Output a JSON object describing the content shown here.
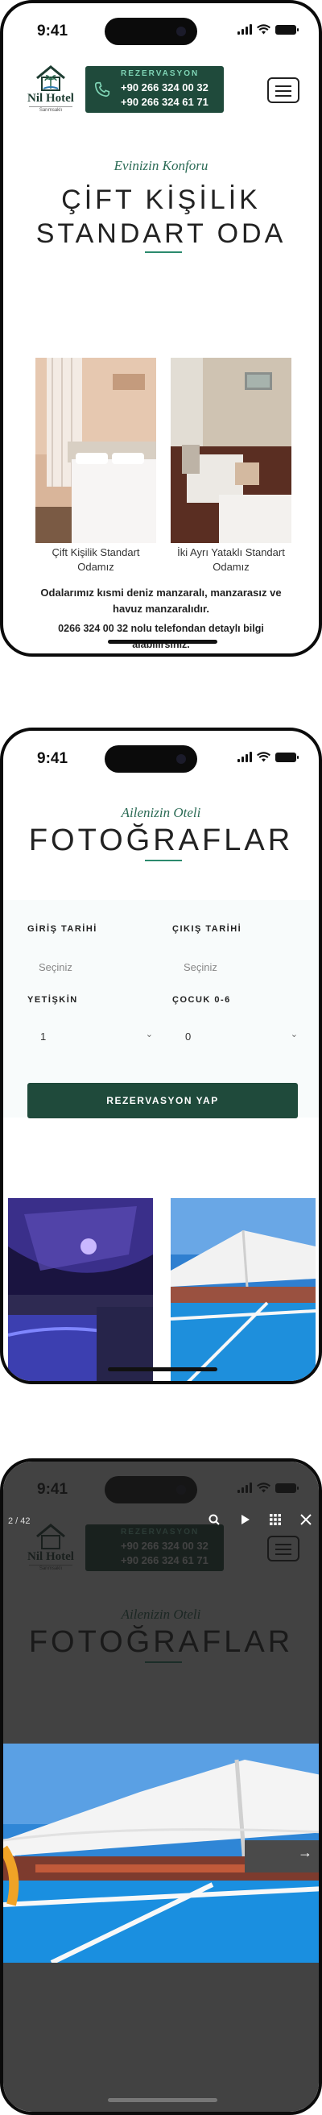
{
  "status": {
    "time": "9:41"
  },
  "header": {
    "logo_name": "Nil Hotel",
    "logo_sub": "Sarımsaklı",
    "rez_title": "REZERVASYON",
    "phone1": "+90 266 324 00 32",
    "phone2": "+90 266 324 61 71"
  },
  "room_section": {
    "kicker": "Evinizin Konforu",
    "title_line1": "ÇİFT KİŞİLİK",
    "title_line2": "STANDART ODA",
    "rooms": [
      {
        "caption_line1": "Çift Kişilik Standart",
        "caption_line2": "Odamız"
      },
      {
        "caption_line1": "İki Ayrı Yataklı Standart",
        "caption_line2": "Odamız"
      }
    ],
    "desc1_line1": "Odalarımız kısmi deniz manzaralı, manzarasız ve",
    "desc1_line2": "havuz manzaralıdır.",
    "desc2_line1": "0266 324 00 32 nolu telefondan detaylı bilgi",
    "desc2_line2": "alabilirsiniz."
  },
  "gallery_section": {
    "kicker": "Ailenizin Oteli",
    "title": "FOTOĞRAFLAR"
  },
  "booking": {
    "checkin_label": "GİRİŞ TARİHİ",
    "checkout_label": "ÇIKIŞ TARİHİ",
    "checkin_placeholder": "Seçiniz",
    "checkout_placeholder": "Seçiniz",
    "adults_label": "YETİŞKİN",
    "children_label": "ÇOCUK 0-6",
    "adults_value": "1",
    "children_value": "0",
    "submit_label": "REZERVASYON YAP"
  },
  "lightbox": {
    "counter": "2 / 42",
    "tools": [
      "search-icon",
      "play-icon",
      "grid-icon",
      "close-icon"
    ]
  },
  "colors": {
    "brand_green": "#1f4a3b",
    "accent_green": "#2b8a6d",
    "kicker_green": "#2b6b55"
  }
}
